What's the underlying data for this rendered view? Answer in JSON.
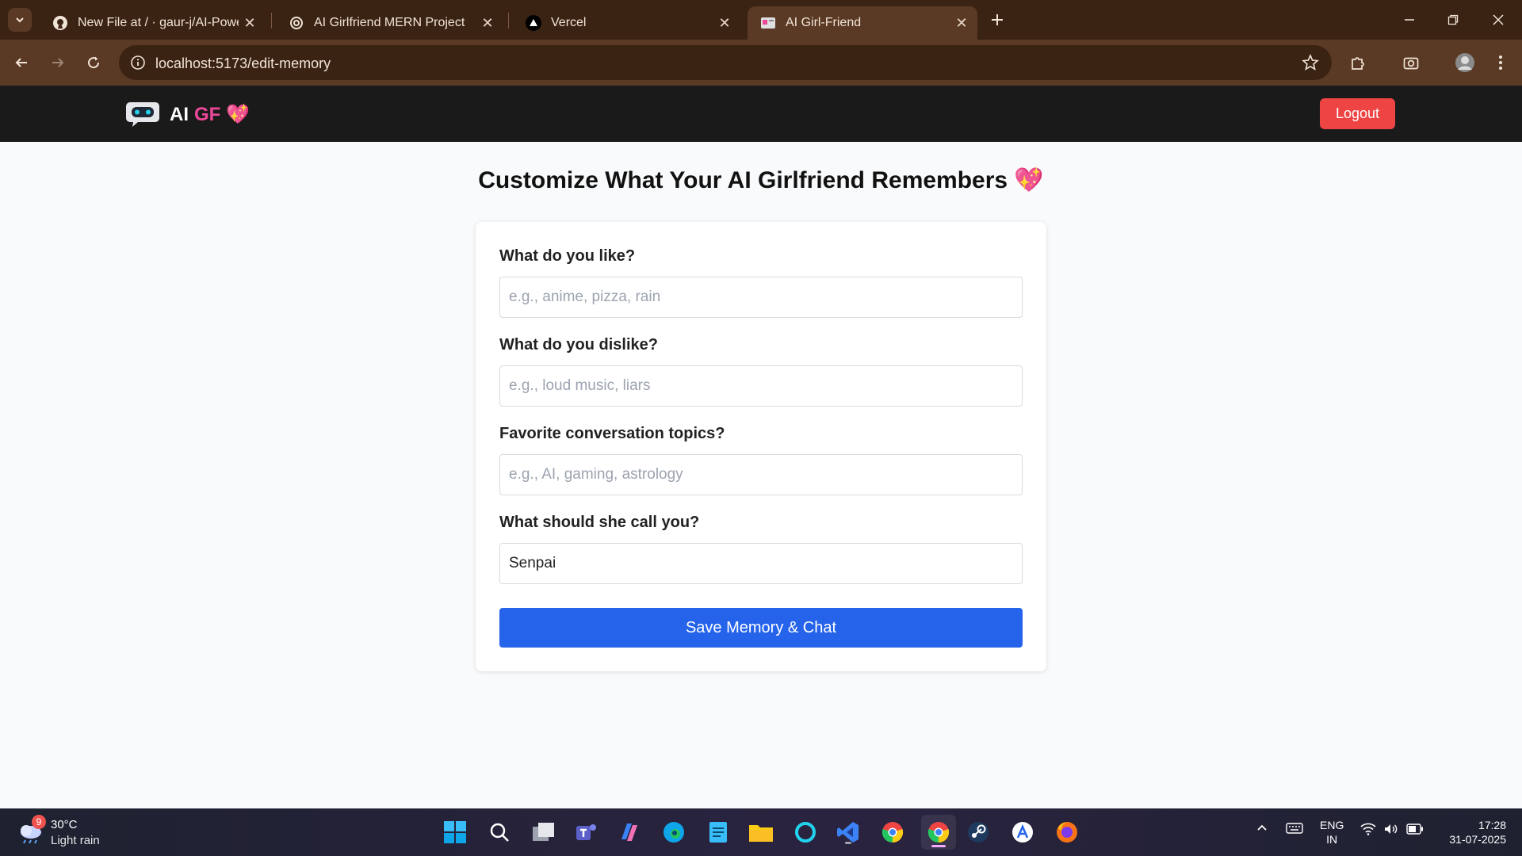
{
  "browser": {
    "tabs": [
      {
        "title": "New File at / · gaur-j/AI-Powere",
        "icon": "github-icon"
      },
      {
        "title": "AI Girlfriend MERN Project",
        "icon": "openai-icon"
      },
      {
        "title": "Vercel",
        "icon": "vercel-icon"
      },
      {
        "title": "AI Girl-Friend",
        "icon": "site-icon",
        "active": true
      }
    ],
    "url": "localhost:5173/edit-memory"
  },
  "app": {
    "brand_ai": "AI",
    "brand_gf": "GF",
    "brand_heart": "💖",
    "logout_label": "Logout"
  },
  "page": {
    "title": "Customize What Your AI Girlfriend Remembers 💖"
  },
  "form": {
    "fields": [
      {
        "label": "What do you like?",
        "placeholder": "e.g., anime, pizza, rain",
        "value": ""
      },
      {
        "label": "What do you dislike?",
        "placeholder": "e.g., loud music, liars",
        "value": ""
      },
      {
        "label": "Favorite conversation topics?",
        "placeholder": "e.g., AI, gaming, astrology",
        "value": ""
      },
      {
        "label": "What should she call you?",
        "placeholder": "",
        "value": "Senpai"
      }
    ],
    "save_label": "Save Memory & Chat"
  },
  "taskbar": {
    "weather_badge": "9",
    "weather_temp": "30°C",
    "weather_desc": "Light rain",
    "lang_line1": "ENG",
    "lang_line2": "IN",
    "time": "17:28",
    "date": "31-07-2025"
  },
  "colors": {
    "accent": "#2563eb",
    "danger": "#ef4444",
    "brand_pink": "#ec4899",
    "nav_bg": "#1a1a1a"
  }
}
